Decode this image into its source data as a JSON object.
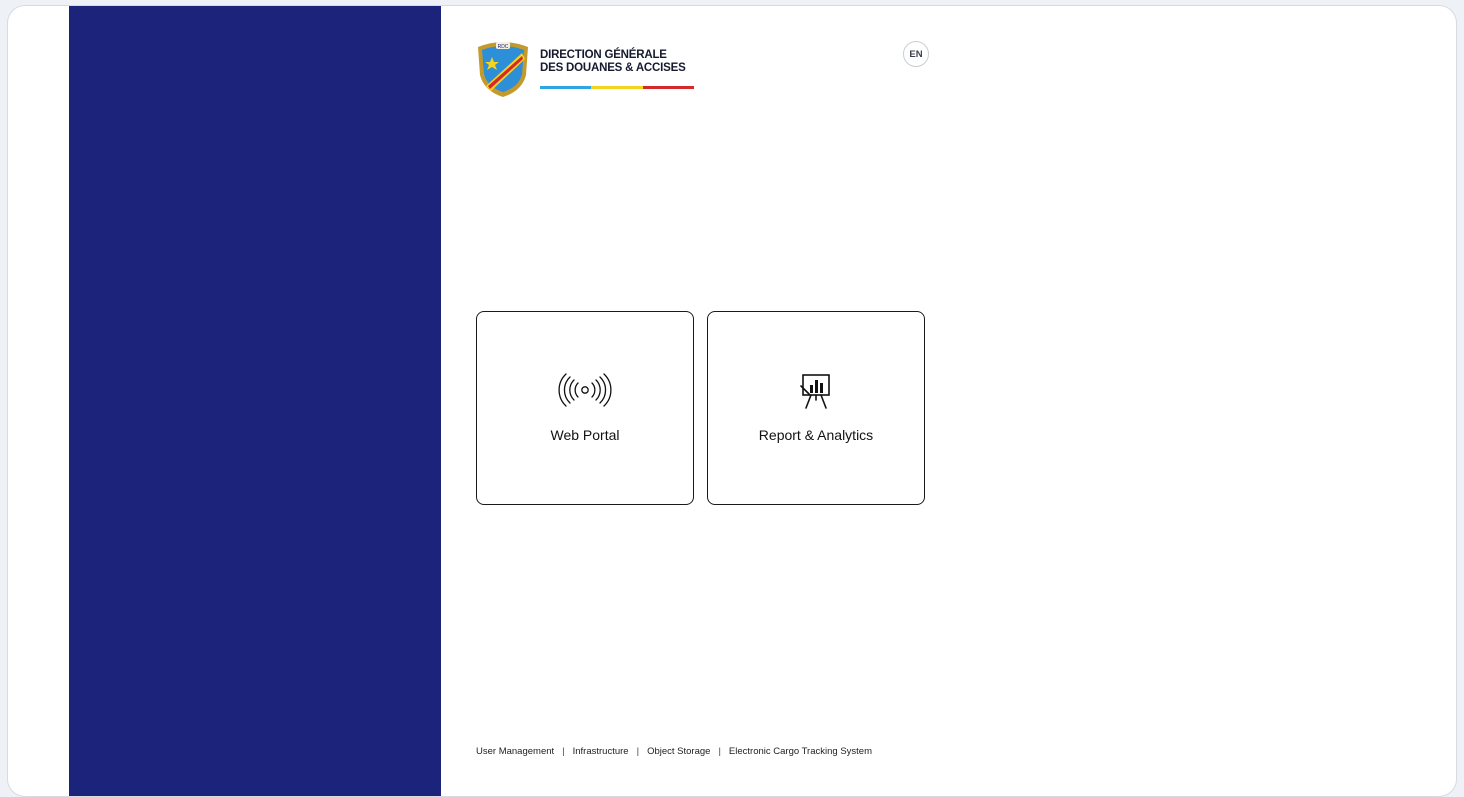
{
  "brand": {
    "line1": "DIRECTION GÉNÉRALE",
    "line2": "DES DOUANES & ACCISES",
    "crest_text": "RDC",
    "flag_colors": [
      "#2da6e3",
      "#f6d31e",
      "#d42a2a"
    ]
  },
  "language": {
    "label": "EN"
  },
  "tiles": [
    {
      "label": "Web Portal",
      "icon": "broadcast-icon"
    },
    {
      "label": "Report & Analytics",
      "icon": "presentation-chart-icon"
    }
  ],
  "footer": {
    "links": [
      "User Management",
      "Infrastructure",
      "Object Storage",
      "Electronic Cargo Tracking System"
    ],
    "separator": "|"
  },
  "colors": {
    "side_panel": "#1b237a",
    "accent_text": "#151a2e"
  }
}
